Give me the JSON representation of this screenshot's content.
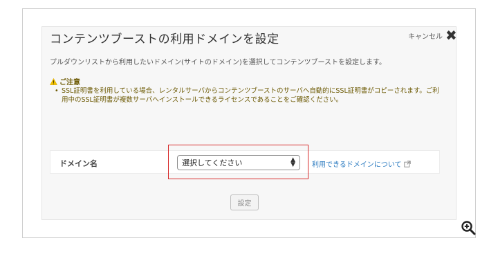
{
  "dialog": {
    "title": "コンテンツブーストの利用ドメインを設定",
    "cancel_label": "キャンセル",
    "cancel_icon": "close-icon",
    "description": "プルダウンリストから利用したいドメイン(サイトのドメイン)を選択してコンテンツブーストを設定します。"
  },
  "notice": {
    "heading": "ご注意",
    "icon": "warning-icon",
    "bullet": "•",
    "body": "SSL証明書を利用している場合、レンタルサーバからコンテンツブーストのサーバへ自動的にSSL証明書がコピーされます。ご利用中のSSL証明書が複数サーバへインストールできるライセンスであることをご確認ください。"
  },
  "domain": {
    "label": "ドメイン名",
    "select_value": "選択してください",
    "link_text": "利用できるドメインについて",
    "link_icon": "external-link-icon"
  },
  "actions": {
    "set_label": "設定"
  },
  "zoom": {
    "icon": "zoom-in-icon"
  },
  "colors": {
    "highlight": "#d72b2b",
    "link": "#2a7ac0",
    "notice_text": "#6b5800",
    "warning": "#f2c200"
  }
}
